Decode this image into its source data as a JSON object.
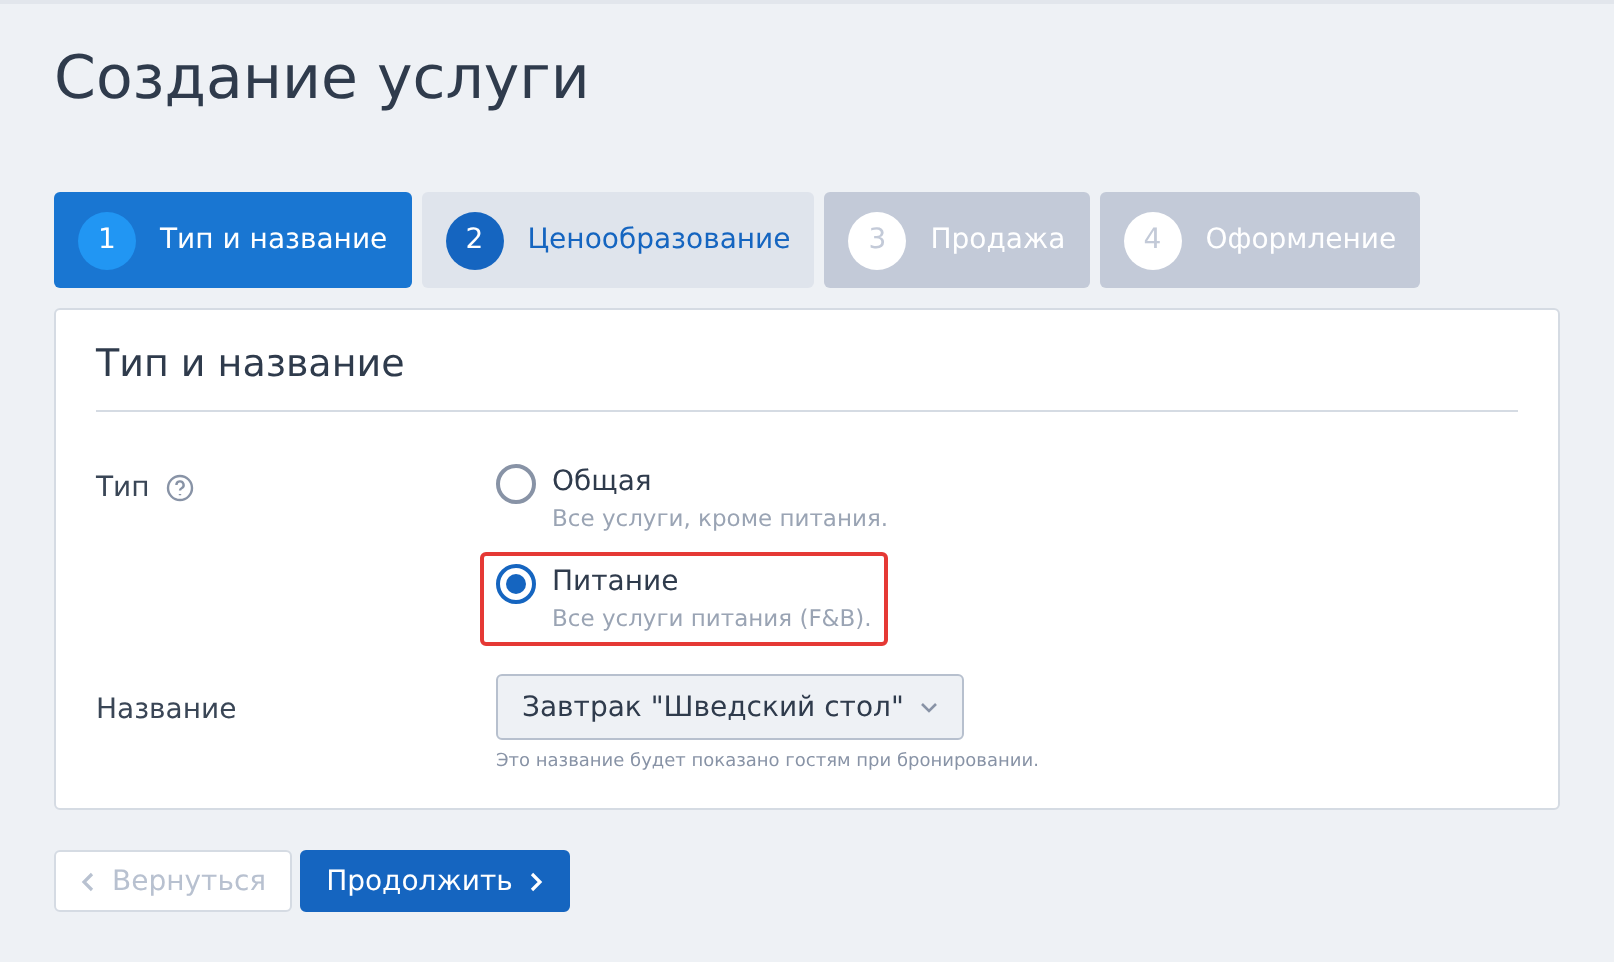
{
  "title": "Создание услуги",
  "steps": [
    {
      "number": "1",
      "label": "Тип и название",
      "selected": true,
      "disabled": false
    },
    {
      "number": "2",
      "label": "Ценообразование",
      "selected": false,
      "disabled": false
    },
    {
      "number": "3",
      "label": "Продажа",
      "selected": false,
      "disabled": true
    },
    {
      "number": "4",
      "label": "Оформление",
      "selected": false,
      "disabled": true
    }
  ],
  "card": {
    "heading": "Тип и название",
    "type_field": {
      "label": "Тип",
      "options": [
        {
          "label": "Общая",
          "hint": "Все услуги, кроме питания.",
          "selected": false,
          "highlighted": false
        },
        {
          "label": "Питание",
          "hint": "Все услуги питания (F&B).",
          "selected": true,
          "highlighted": true
        }
      ]
    },
    "name_field": {
      "label": "Название",
      "value": "Завтрак \"Шведский стол\"",
      "hint": "Это название будет показано гостям при бронировании."
    }
  },
  "buttons": {
    "back": {
      "label": "Вернуться",
      "disabled": true
    },
    "next": {
      "label": "Продолжить",
      "disabled": false
    }
  }
}
